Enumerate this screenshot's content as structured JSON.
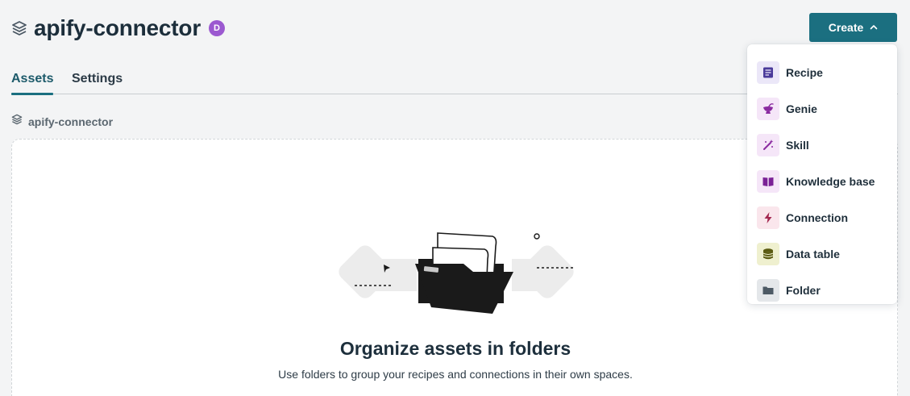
{
  "header": {
    "title": "apify-connector",
    "owner_initial": "D",
    "create_label": "Create"
  },
  "tabs": [
    {
      "label": "Assets",
      "active": true
    },
    {
      "label": "Settings",
      "active": false
    }
  ],
  "breadcrumb": {
    "label": "apify-connector"
  },
  "empty_state": {
    "title": "Organize assets in folders",
    "text": "Use folders to group your recipes and connections in their own spaces."
  },
  "create_menu": {
    "items": [
      {
        "label": "Recipe",
        "icon": "recipe-icon",
        "color": "#4a3a9a",
        "bg": "#ebe7f8"
      },
      {
        "label": "Genie",
        "icon": "genie-icon",
        "color": "#8a2aa0",
        "bg": "#f5e6f8"
      },
      {
        "label": "Skill",
        "icon": "skill-icon",
        "color": "#8a2aa0",
        "bg": "#f5e6f8"
      },
      {
        "label": "Knowledge base",
        "icon": "book-icon",
        "color": "#7a2196",
        "bg": "#f5e6f8"
      },
      {
        "label": "Connection",
        "icon": "lightning-icon",
        "color": "#a3274f",
        "bg": "#fae6ec"
      },
      {
        "label": "Data table",
        "icon": "database-icon",
        "color": "#5a5a10",
        "bg": "#eff0cf"
      },
      {
        "label": "Folder",
        "icon": "folder-icon",
        "color": "#4d5a65",
        "bg": "#e4e7ea"
      }
    ]
  },
  "colors": {
    "accent": "#1b6f80",
    "badge": "#9b59d0"
  }
}
